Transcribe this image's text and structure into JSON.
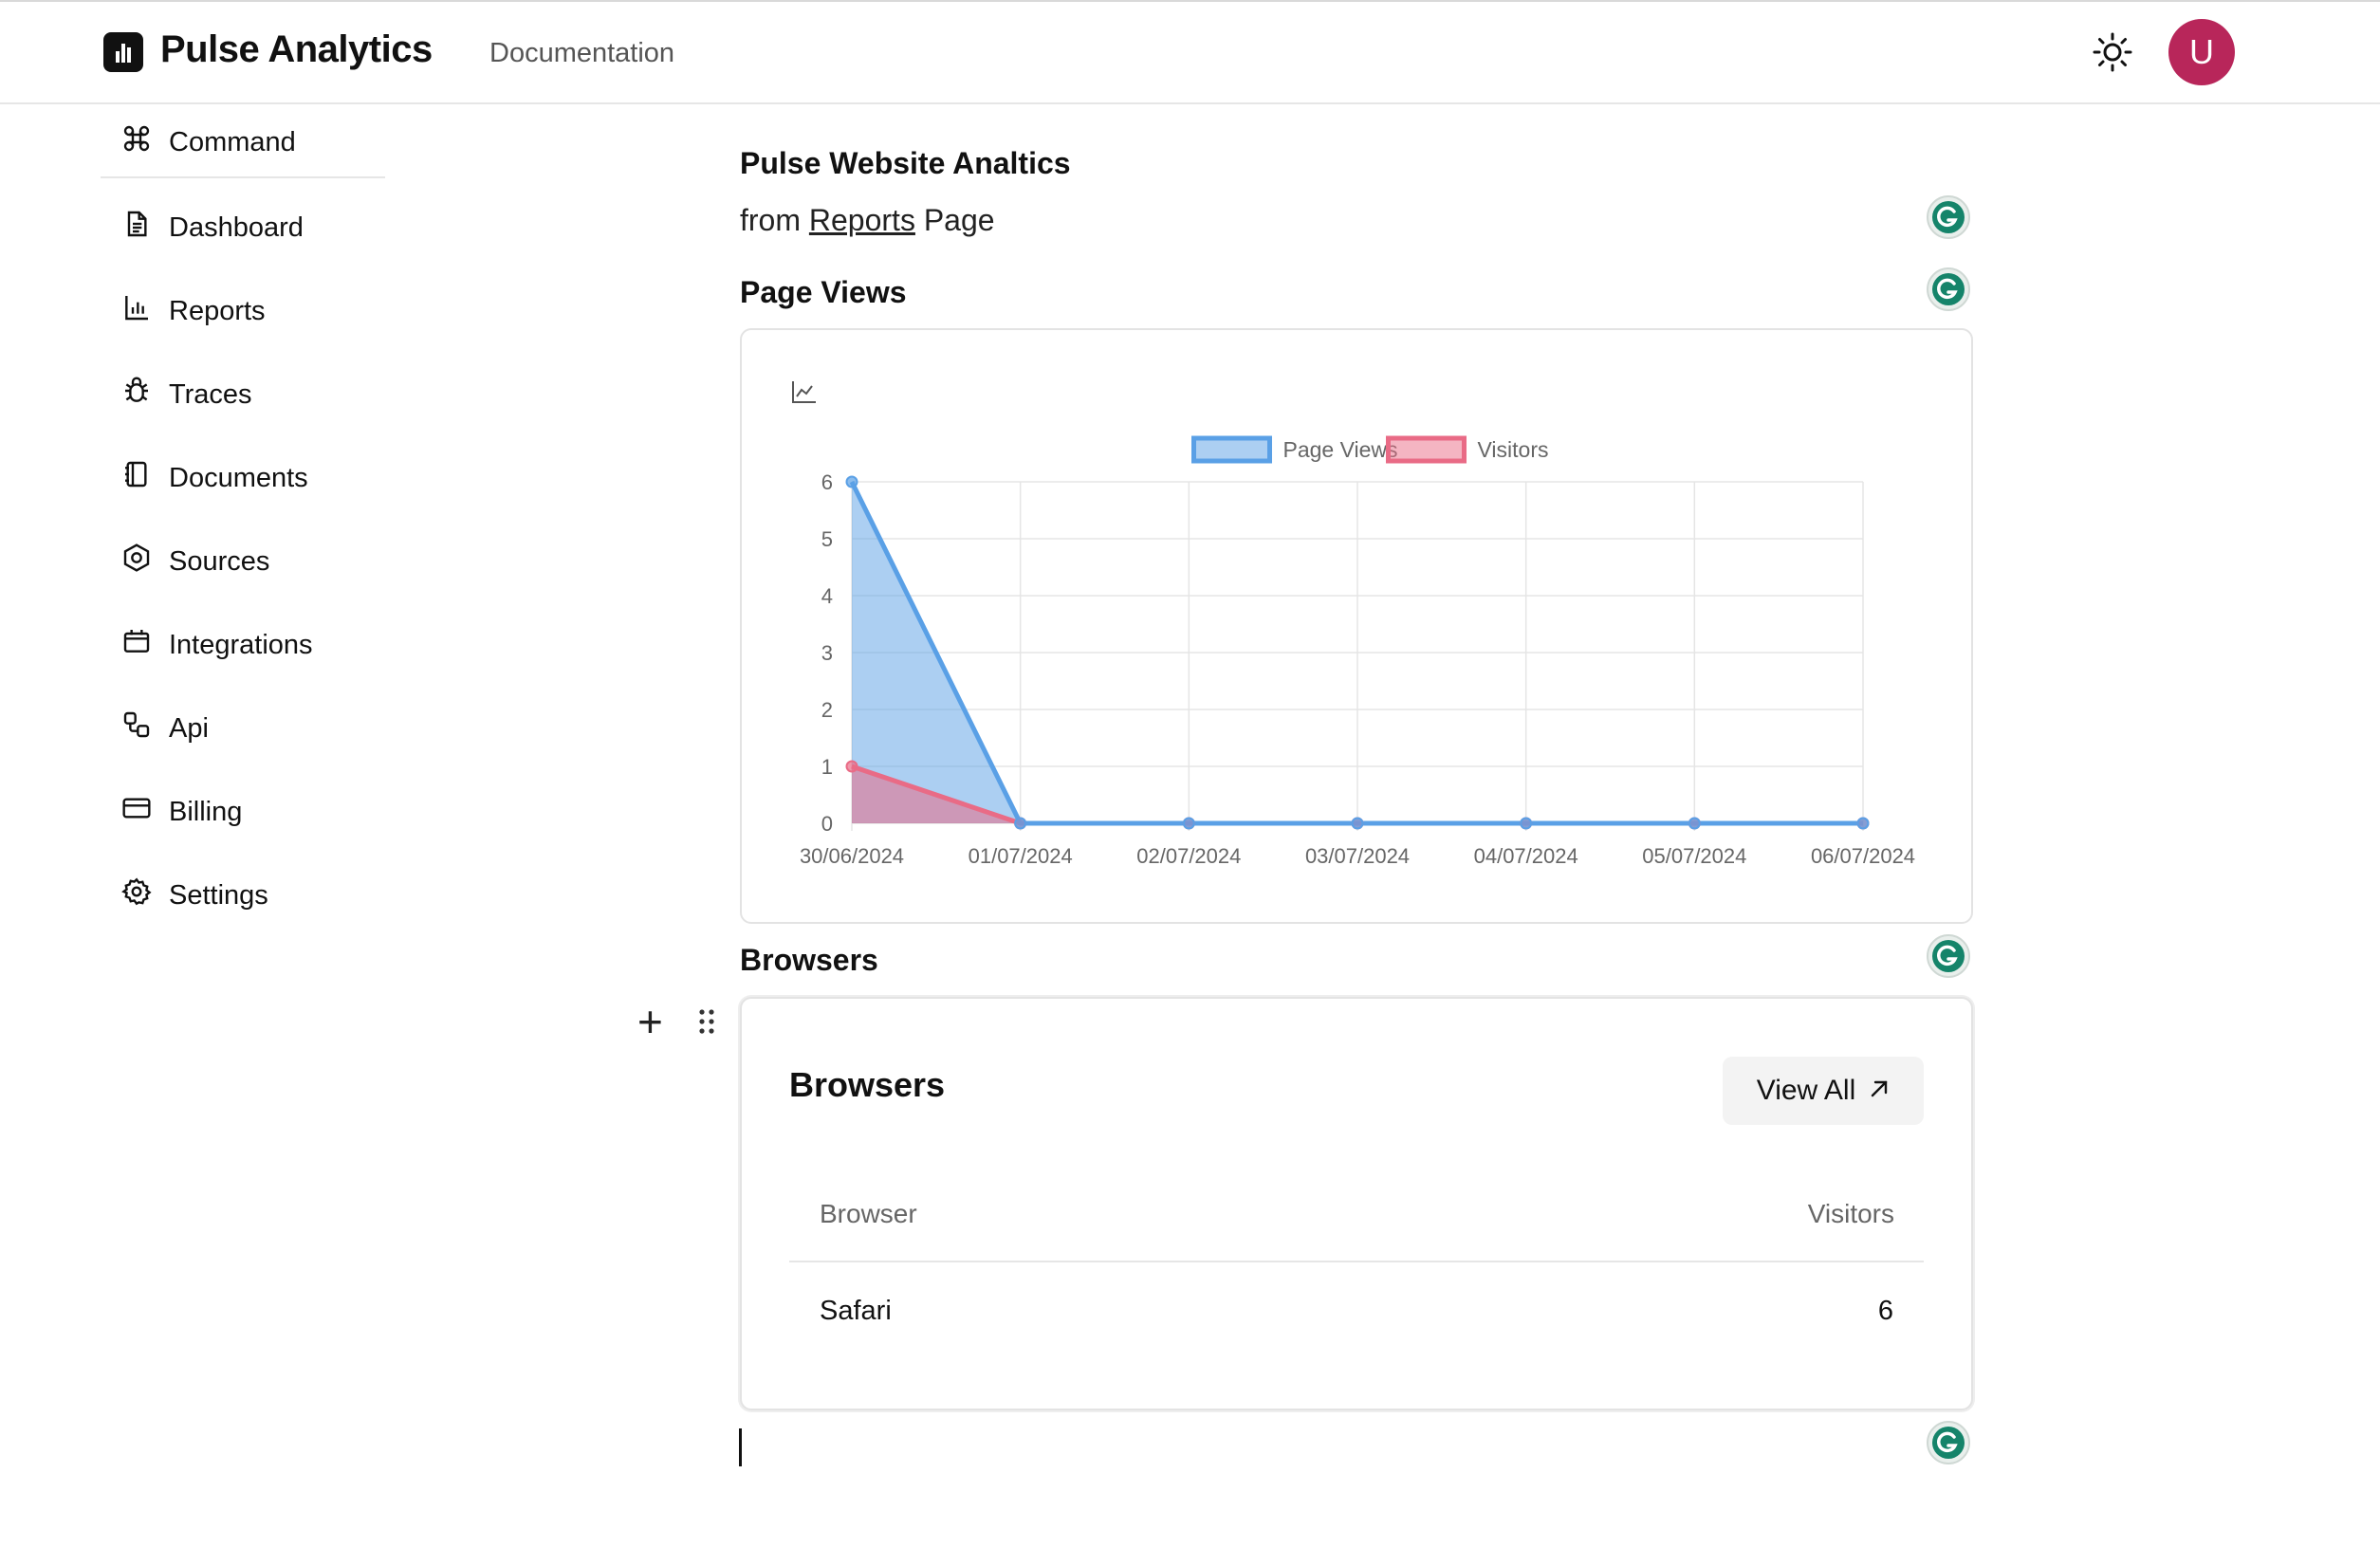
{
  "header": {
    "app_title": "Pulse Analytics",
    "doc_link": "Documentation",
    "avatar_letter": "U"
  },
  "sidebar": {
    "items": [
      {
        "label": "Command",
        "icon": "command-icon"
      },
      {
        "label": "Dashboard",
        "icon": "file-text-icon"
      },
      {
        "label": "Reports",
        "icon": "bar-chart-icon"
      },
      {
        "label": "Traces",
        "icon": "bug-icon"
      },
      {
        "label": "Documents",
        "icon": "notebook-icon"
      },
      {
        "label": "Sources",
        "icon": "hexagon-icon"
      },
      {
        "label": "Integrations",
        "icon": "calendar-icon"
      },
      {
        "label": "Api",
        "icon": "api-icon"
      },
      {
        "label": "Billing",
        "icon": "credit-card-icon"
      },
      {
        "label": "Settings",
        "icon": "gear-icon"
      }
    ]
  },
  "main": {
    "title": "Pulse Website Analtics",
    "subtitle_prefix": "from",
    "subtitle_link": "Reports",
    "subtitle_suffix": "Page",
    "page_views_heading": "Page Views",
    "browsers_heading": "Browsers"
  },
  "browsers_card": {
    "title": "Browsers",
    "view_all_label": "View All",
    "columns": [
      "Browser",
      "Visitors"
    ],
    "rows": [
      {
        "browser": "Safari",
        "visitors": "6"
      }
    ]
  },
  "chart_data": {
    "type": "area",
    "x": [
      "30/06/2024",
      "01/07/2024",
      "02/07/2024",
      "03/07/2024",
      "04/07/2024",
      "05/07/2024",
      "06/07/2024"
    ],
    "series": [
      {
        "name": "Page Views",
        "values": [
          6,
          0,
          0,
          0,
          0,
          0,
          0
        ],
        "color": "#5aa0e6"
      },
      {
        "name": "Visitors",
        "values": [
          1,
          0,
          0,
          0,
          0,
          0,
          0
        ],
        "color": "#e96b86"
      }
    ],
    "ylim": [
      0,
      6
    ],
    "yticks": [
      0,
      1,
      2,
      3,
      4,
      5,
      6
    ],
    "grid": true,
    "legend": "top-center",
    "title": "",
    "xlabel": "",
    "ylabel": ""
  },
  "colors": {
    "accent": "#b8265a",
    "page_views": "#5aa0e6",
    "visitors": "#e96b86",
    "grammarly": "#15846a"
  }
}
